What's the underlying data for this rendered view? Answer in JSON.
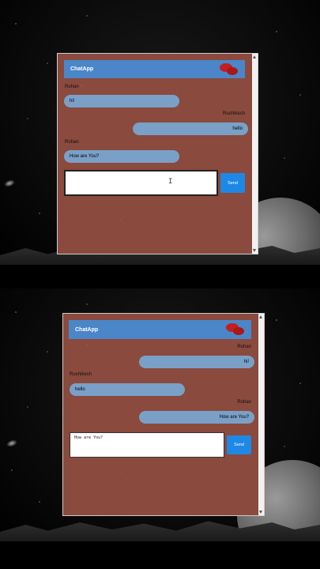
{
  "app": {
    "title": "ChatApp",
    "icon": "chat-bubbles-icon",
    "accent": "#4a86c8",
    "send_color": "#1e88e5"
  },
  "top": {
    "messages": [
      {
        "sender": "Rohan",
        "text": "hi!",
        "align": "left"
      },
      {
        "sender": "Rushikesh",
        "text": "hello",
        "align": "right"
      },
      {
        "sender": "Rohan",
        "text": "How are You?",
        "align": "left"
      }
    ],
    "input_value": "",
    "send_label": "Send"
  },
  "bottom": {
    "messages": [
      {
        "sender": "Rohan",
        "text": "hi!",
        "align": "right"
      },
      {
        "sender": "Rushikesh",
        "text": "hello",
        "align": "left"
      },
      {
        "sender": "Rohan",
        "text": "How are You?",
        "align": "right"
      }
    ],
    "input_value": "How are You?",
    "send_label": "Send"
  }
}
